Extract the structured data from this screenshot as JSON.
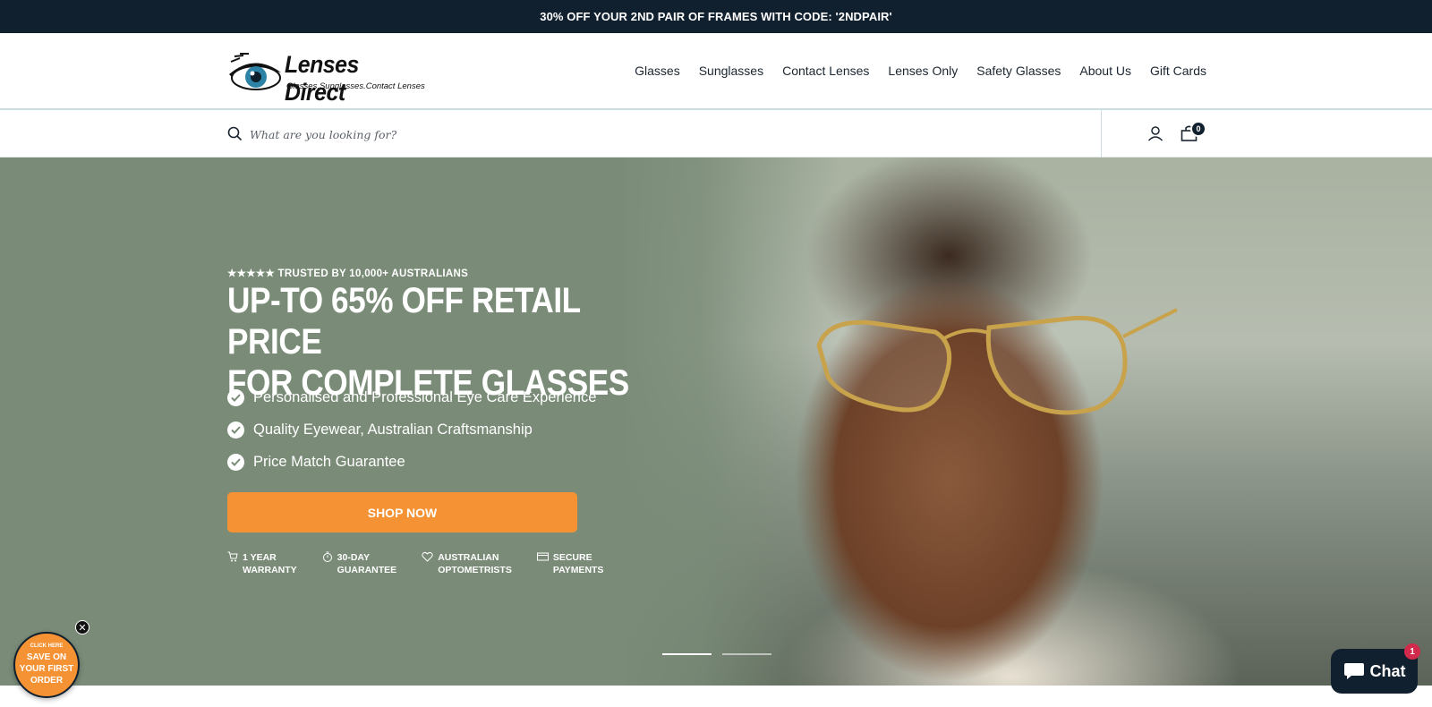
{
  "announcement": {
    "text": "30% OFF YOUR 2ND PAIR OF FRAMES WITH CODE: '2NDPAIR'"
  },
  "header": {
    "logo_name": "Lenses Direct",
    "logo_tagline": "Glasses.Sunglasses.Contact Lenses",
    "nav": [
      "Glasses",
      "Sunglasses",
      "Contact Lenses",
      "Lenses Only",
      "Safety Glasses",
      "About Us",
      "Gift Cards"
    ]
  },
  "search": {
    "placeholder": "What are you looking for?"
  },
  "cart": {
    "count": "0"
  },
  "hero": {
    "trusted": "★★★★★ TRUSTED BY 10,000+ AUSTRALIANS",
    "headline_line1": "UP-TO 65% OFF RETAIL PRICE",
    "headline_line2": "FOR COMPLETE GLASSES",
    "features": [
      "Personalised and Professional Eye Care Experience",
      "Quality Eyewear, Australian Craftsmanship",
      "Price Match Guarantee"
    ],
    "cta_label": "SHOP NOW",
    "badges": [
      {
        "icon": "cart-icon",
        "line1": "1 YEAR",
        "line2": "WARRANTY"
      },
      {
        "icon": "timer-icon",
        "line1": "30-DAY",
        "line2": "GUARANTEE"
      },
      {
        "icon": "heart-icon",
        "line1": "AUSTRALIAN",
        "line2": "OPTOMETRISTS"
      },
      {
        "icon": "card-icon",
        "line1": "SECURE",
        "line2": "PAYMENTS"
      }
    ]
  },
  "promo": {
    "small": "CLICK HERE",
    "line1": "SAVE ON",
    "line2": "YOUR FIRST",
    "line3": "ORDER"
  },
  "chat": {
    "label": "Chat",
    "badge": "1"
  },
  "colors": {
    "announce_bg": "#11202f",
    "hero_bg": "#7a8c78",
    "cta": "#f59334"
  }
}
